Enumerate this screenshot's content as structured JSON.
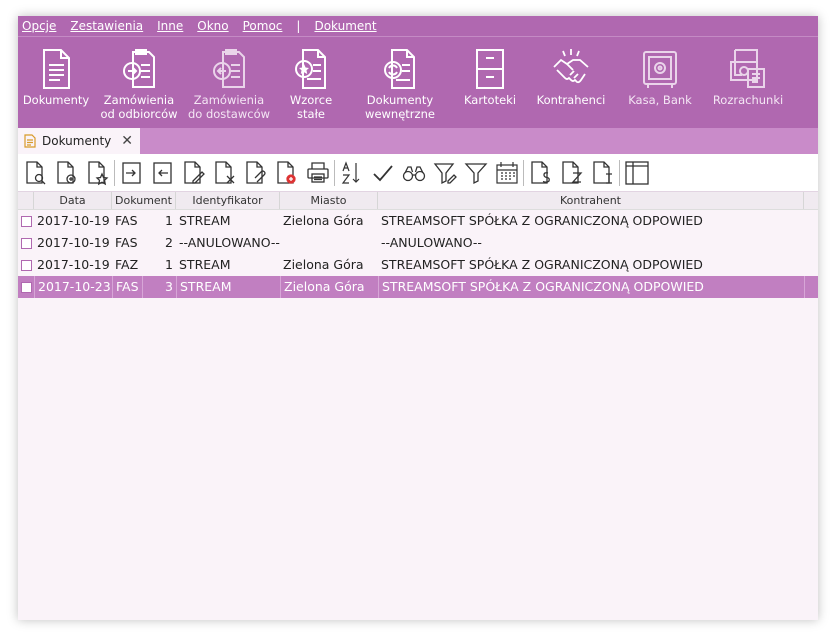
{
  "menu": {
    "items": [
      "Opcje",
      "Zestawienia",
      "Inne",
      "Okno",
      "Pomoc"
    ],
    "separator": "|",
    "extra": "Dokument"
  },
  "ribbon": {
    "buttons": [
      {
        "line1": "Dokumenty",
        "line2": "",
        "icon": "document-icon"
      },
      {
        "line1": "Zamówienia",
        "line2": "od odbiorców",
        "icon": "order-incoming-icon"
      },
      {
        "line1": "Zamówienia",
        "line2": "do dostawców",
        "icon": "order-outgoing-icon"
      },
      {
        "line1": "Wzorce",
        "line2": "stałe",
        "icon": "template-star-icon"
      },
      {
        "line1": "Dokumenty",
        "line2": "wewnętrzne",
        "icon": "internal-document-icon"
      },
      {
        "line1": "Kartoteki",
        "line2": "",
        "icon": "file-cabinet-icon"
      },
      {
        "line1": "Kontrahenci",
        "line2": "",
        "icon": "handshake-icon"
      },
      {
        "line1": "Kasa, Bank",
        "line2": "",
        "icon": "safe-icon"
      },
      {
        "line1": "Rozrachunki",
        "line2": "",
        "icon": "settlements-icon"
      }
    ]
  },
  "tabs": [
    {
      "label": "Dokumenty",
      "close": "✕"
    }
  ],
  "toolbar": {
    "buttons": [
      "preview-document-icon",
      "new-document-icon",
      "favorite-document-icon",
      "import-icon",
      "export-icon",
      "edit-document-icon",
      "delete-document-icon",
      "attach-document-icon",
      "add-document-icon",
      "print-icon",
      "sort-az-icon",
      "check-icon",
      "binoculars-icon",
      "filter-edit-icon",
      "filter-icon",
      "calendar-icon",
      "document-s-icon",
      "document-z-icon",
      "document-info-icon",
      "columns-icon"
    ]
  },
  "grid": {
    "columns": [
      "Data",
      "Dokument",
      "Identyfikator",
      "Miasto",
      "Kontrahent"
    ],
    "rows": [
      {
        "data": "2017-10-19",
        "dok": "FAS",
        "num": "1",
        "id": "STREAM",
        "miasto": "Zielona Góra",
        "kontrahent": "STREAMSOFT SPÓŁKA Z OGRANICZONĄ ODPOWIED",
        "selected": false
      },
      {
        "data": "2017-10-19",
        "dok": "FAS",
        "num": "2",
        "id": "--ANULOWANO--",
        "miasto": "",
        "kontrahent": "--ANULOWANO--",
        "selected": false
      },
      {
        "data": "2017-10-19",
        "dok": "FAZ",
        "num": "1",
        "id": "STREAM",
        "miasto": "Zielona Góra",
        "kontrahent": "STREAMSOFT SPÓŁKA Z OGRANICZONĄ ODPOWIED",
        "selected": false
      },
      {
        "data": "2017-10-23",
        "dok": "FAS",
        "num": "3",
        "id": "STREAM",
        "miasto": "Zielona Góra",
        "kontrahent": "STREAMSOFT SPÓŁKA Z OGRANICZONĄ ODPOWIED",
        "selected": true
      }
    ]
  },
  "colors": {
    "accent": "#b068b0",
    "selected_row": "#c17fc1",
    "tabstrip": "#c98bc9",
    "background": "#faf3f9"
  }
}
